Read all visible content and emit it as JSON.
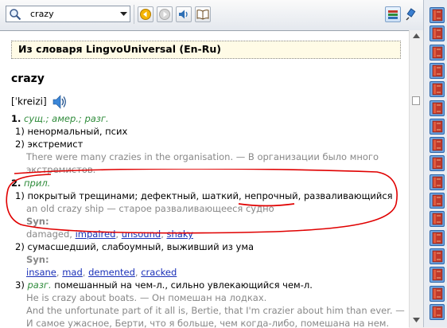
{
  "search": {
    "value": "crazy"
  },
  "dictionary": {
    "banner": "Из словаря LingvoUniversal (En-Ru)"
  },
  "entry": {
    "headword": "crazy",
    "transcription": "[ˈkreizi]",
    "pos1": {
      "num": "1.",
      "labels": "сущ.; амер.; разг.",
      "senses": [
        {
          "num": "1)",
          "text": "ненормальный, псих"
        },
        {
          "num": "2)",
          "text": "экстремист"
        }
      ],
      "example_line1": "There were many crazies in the organisation. — В организации было много",
      "example_line2": "экстремистов."
    },
    "pos2": {
      "num": "2.",
      "label": "прил.",
      "sense1_num": "1)",
      "sense1_a": "покрытый трещинами; дефектный, шаткий, ",
      "sense1_b": "непрочный",
      "sense1_c": ", разваливающийся",
      "sense1_example": "an old crazy ship — старое разваливающееся судно",
      "syn_label": "Syn:",
      "syn1_plain": "damaged, ",
      "syn1_links": [
        "impaired",
        "unsound",
        "shaky"
      ],
      "sense2_num": "2)",
      "sense2_text": "сумасшедший, слабоумный, выживший из ума",
      "syn2_links": [
        "insane",
        "mad",
        "demented",
        "cracked"
      ],
      "sense3_num": "3)",
      "sense3_label": "разг.",
      "sense3_text": " помешанный на чем-л., сильно увлекающийся чем-л.",
      "sense3_ex1": "He is crazy about boats. — Он помешан на лодках.",
      "sense3_ex2": "And the unfortunate part of it all is, Bertie, that I'm crazier about him than ever. —",
      "sense3_ex3": "И самое ужасное, Берти, что я больше, чем когда-либо, помешана на нем."
    }
  },
  "colors": {
    "label_green": "#2e8b3a",
    "link_blue": "#1a30b8",
    "example_gray": "#888888",
    "annotation_red": "#e00000"
  }
}
